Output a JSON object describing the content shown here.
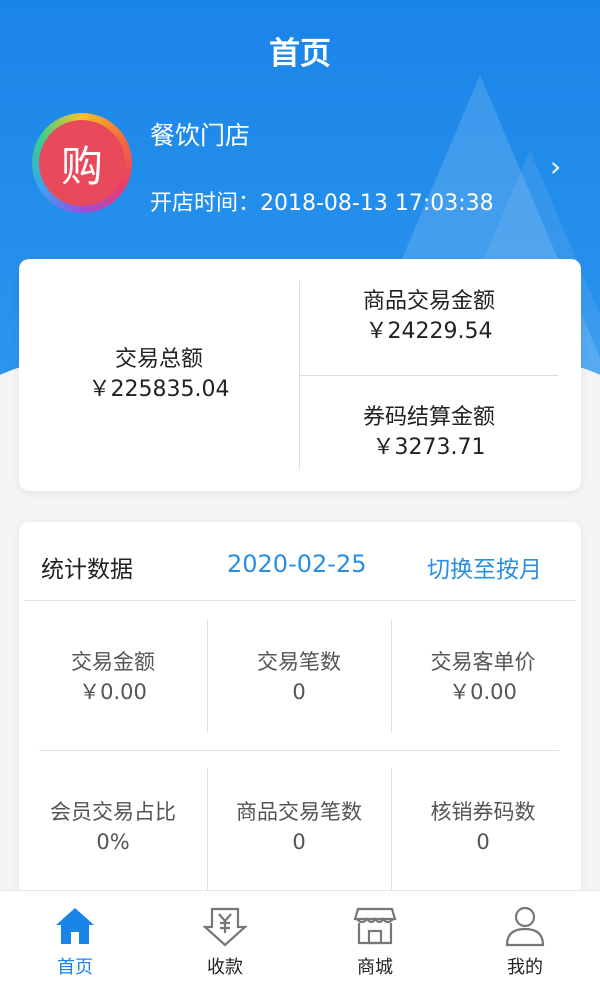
{
  "header": {
    "title": "首页",
    "store_name": "餐饮门店",
    "open_time": "开店时间：2018-08-13 17:03:38",
    "avatar_glyph": "购"
  },
  "summary": {
    "total_label": "交易总额",
    "total_value": "￥225835.04",
    "goods_label": "商品交易金额",
    "goods_value": "￥24229.54",
    "coupon_label": "券码结算金额",
    "coupon_value": "￥3273.71"
  },
  "stats": {
    "title": "统计数据",
    "date": "2020-02-25",
    "switch_label": "切换至按月",
    "cells": [
      {
        "label": "交易金额",
        "value": "￥0.00"
      },
      {
        "label": "交易笔数",
        "value": "0"
      },
      {
        "label": "交易客单价",
        "value": "￥0.00"
      },
      {
        "label": "会员交易占比",
        "value": "0%"
      },
      {
        "label": "商品交易笔数",
        "value": "0"
      },
      {
        "label": "核销券码数",
        "value": "0"
      }
    ]
  },
  "tabs": [
    {
      "label": "首页",
      "icon": "home-icon",
      "active": true
    },
    {
      "label": "收款",
      "icon": "yen-download-icon",
      "active": false
    },
    {
      "label": "商城",
      "icon": "shop-icon",
      "active": false
    },
    {
      "label": "我的",
      "icon": "user-icon",
      "active": false
    }
  ],
  "colors": {
    "primary": "#1a85e8",
    "accent_text": "#2a8ee2"
  }
}
